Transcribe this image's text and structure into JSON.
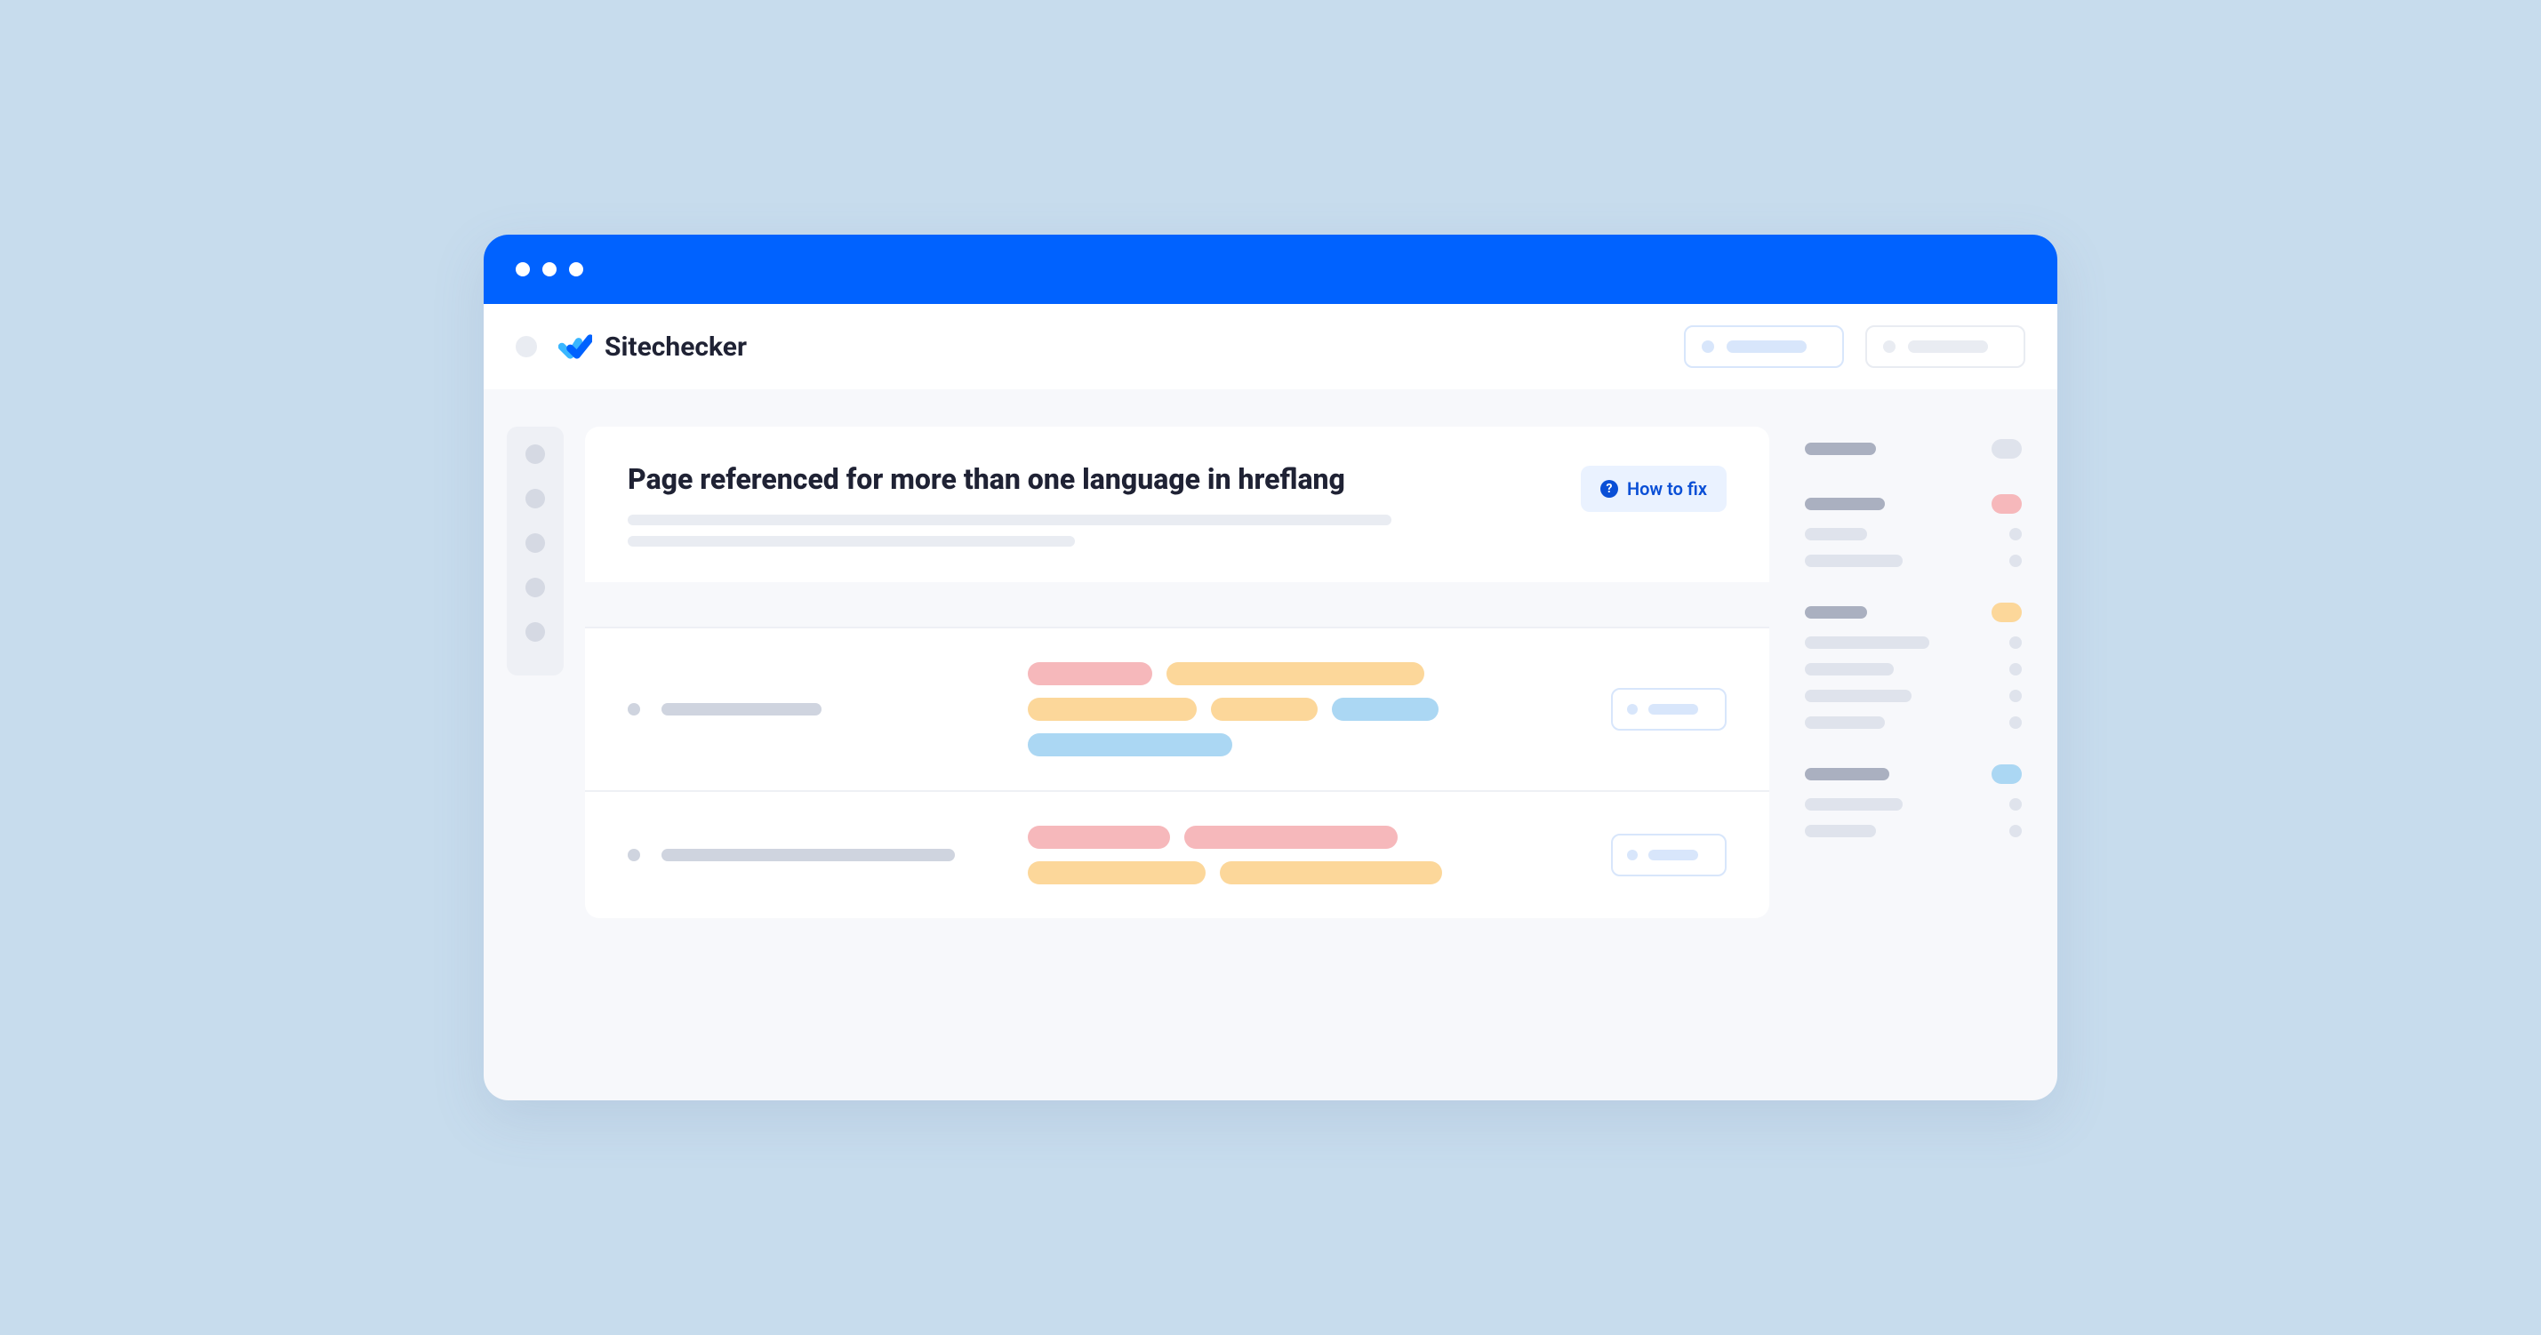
{
  "app": {
    "name": "Sitechecker"
  },
  "card": {
    "title": "Page referenced for more than one language in hreflang",
    "howToFix": "How to fix"
  }
}
